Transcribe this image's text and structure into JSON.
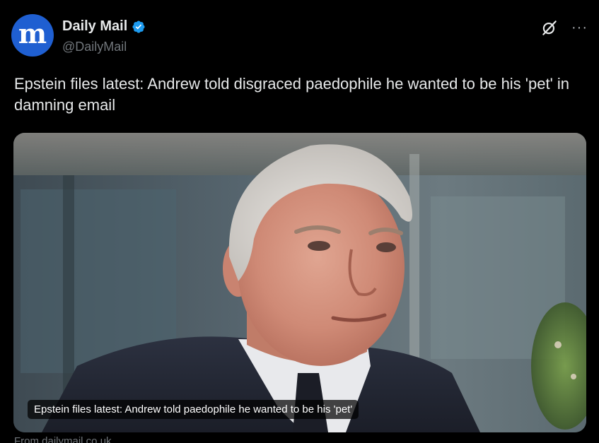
{
  "author": {
    "display_name": "Daily Mail",
    "handle": "@DailyMail",
    "avatar_letter": "m",
    "verified": true
  },
  "icons": {
    "grok": "grok-icon",
    "more": "more-icon",
    "verified": "verified-badge-icon"
  },
  "tweet": {
    "text": "Epstein files latest: Andrew told disgraced paedophile he wanted to be his 'pet' in damning email"
  },
  "card": {
    "caption": "Epstein files latest: Andrew told paedophile he wanted to be his 'pet'",
    "source": "From dailymail.co.uk"
  },
  "colors": {
    "background": "#000000",
    "text": "#e7e9ea",
    "muted": "#71767b",
    "avatar": "#1f5fd1",
    "verified": "#1d9bf0"
  }
}
